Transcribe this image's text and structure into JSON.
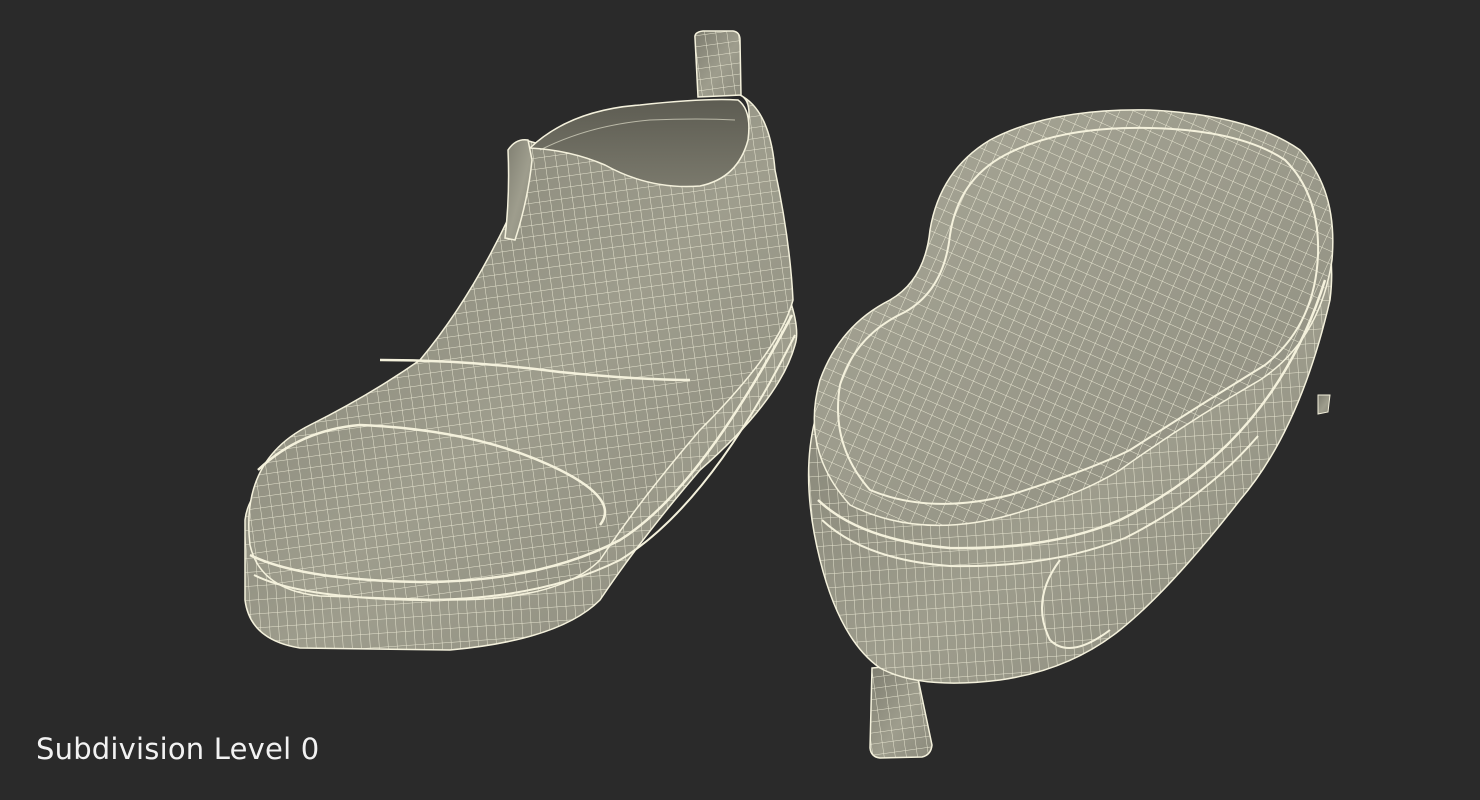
{
  "caption": {
    "text": "Subdivision Level 0"
  },
  "scene": {
    "objects": [
      {
        "name": "shoe-side-view",
        "render": "wireframe"
      },
      {
        "name": "shoe-sole-view",
        "render": "wireframe"
      }
    ]
  },
  "colors": {
    "background": "#2a2a2a",
    "mesh_fill": "#9c9b8b",
    "mesh_fill_dark": "#6f6e62",
    "wire": "#f4f1dc",
    "caption": "#f2f2f2"
  }
}
